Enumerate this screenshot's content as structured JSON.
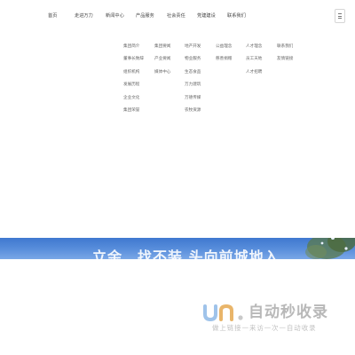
{
  "nav": {
    "items": [
      "首页",
      "走进万力",
      "新闻中心",
      "产品服务",
      "社会责任",
      "党建建设",
      "联系我们"
    ]
  },
  "menu_icon": "hamburger-icon",
  "megamenu": {
    "columns": [
      [
        "集团简介",
        "董事长致辞",
        "组织机构",
        "发展历程",
        "企业文化",
        "集团荣誉"
      ],
      [
        "集团要闻",
        "产业要闻",
        "媒体中心"
      ],
      [
        "地产开发",
        "物业服务",
        "生态食品",
        "万力建筑",
        "万德传媒",
        "农牧资源"
      ],
      [
        "公益理念",
        "慈善捐赠"
      ],
      [
        "人才理念",
        "员工天地",
        "人才招聘"
      ],
      [
        "联系我们",
        "友情链接"
      ]
    ]
  },
  "banner": {
    "title": "立余…找不装 头向前城地入",
    "color": "#4a82d6"
  },
  "watermark": {
    "icon": "brand-logo",
    "text": "自动秒收录",
    "subtext": "做上链接一来访一次一自动收录"
  }
}
